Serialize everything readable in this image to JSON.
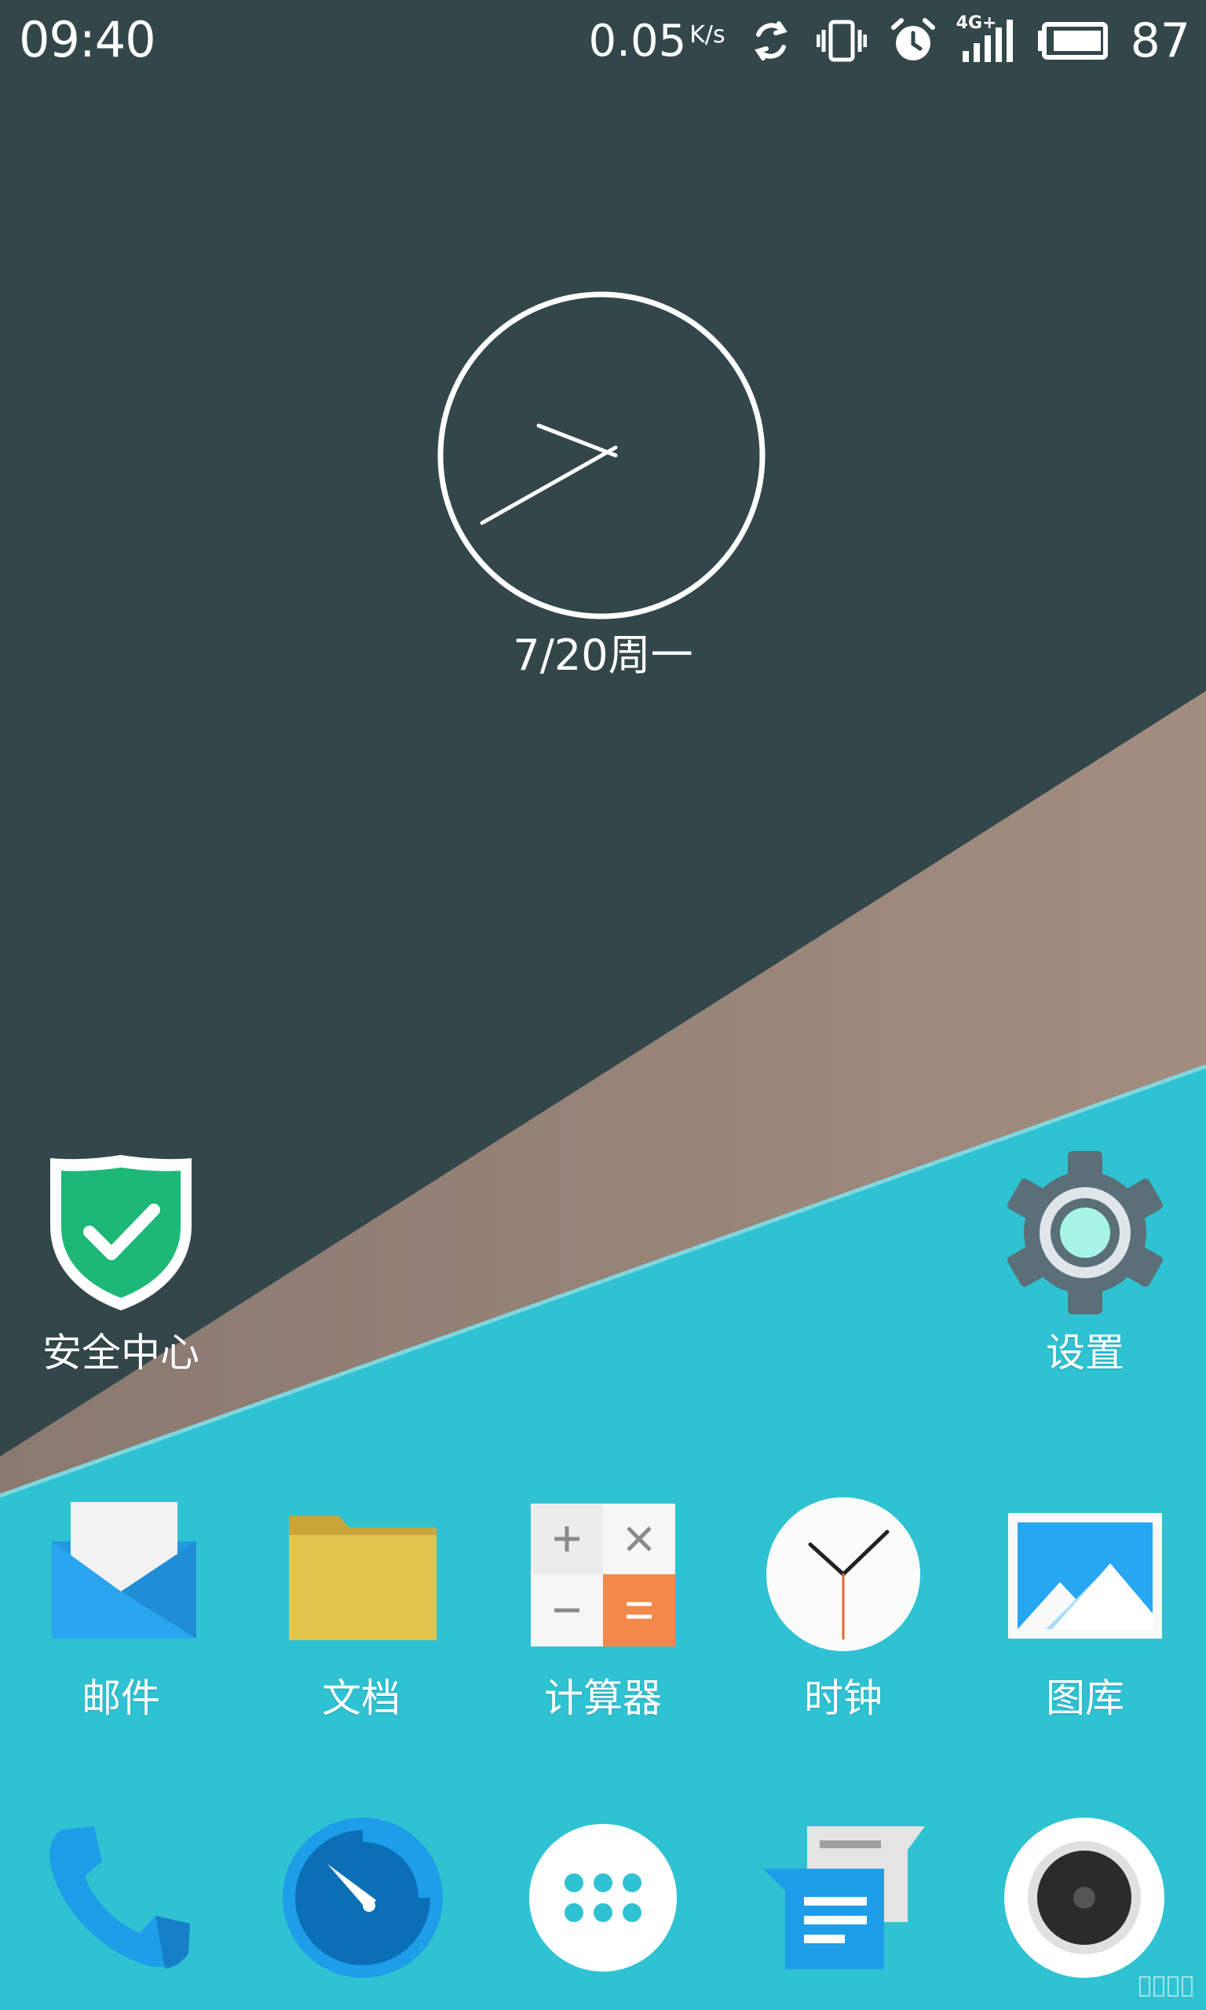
{
  "status_bar": {
    "time": "09:40",
    "net_speed": "0.05",
    "net_speed_unit": "K/s",
    "network_type": "4G+",
    "battery_level": "87"
  },
  "clock_widget": {
    "date_text": "7/20周一"
  },
  "apps": {
    "security": {
      "label": "安全中心",
      "icon": "shield-check-icon"
    },
    "settings": {
      "label": "设置",
      "icon": "gear-icon"
    },
    "mail": {
      "label": "邮件",
      "icon": "envelope-icon"
    },
    "files": {
      "label": "文档",
      "icon": "folder-icon"
    },
    "calculator": {
      "label": "计算器",
      "icon": "calculator-icon"
    },
    "clock": {
      "label": "时钟",
      "icon": "clock-icon"
    },
    "gallery": {
      "label": "图库",
      "icon": "picture-icon"
    }
  },
  "dock": [
    {
      "name": "phone",
      "icon": "phone-icon"
    },
    {
      "name": "browser",
      "icon": "compass-icon"
    },
    {
      "name": "app-drawer",
      "icon": "app-grid-icon"
    },
    {
      "name": "messages",
      "icon": "message-icon"
    },
    {
      "name": "camera",
      "icon": "camera-icon"
    }
  ],
  "colors": {
    "wallpaper_dark": "#33474a",
    "wallpaper_tan": "#9c877b",
    "wallpaper_teal": "#2fc2d2",
    "accent_green": "#1db877",
    "accent_blue": "#1e9de9"
  }
}
